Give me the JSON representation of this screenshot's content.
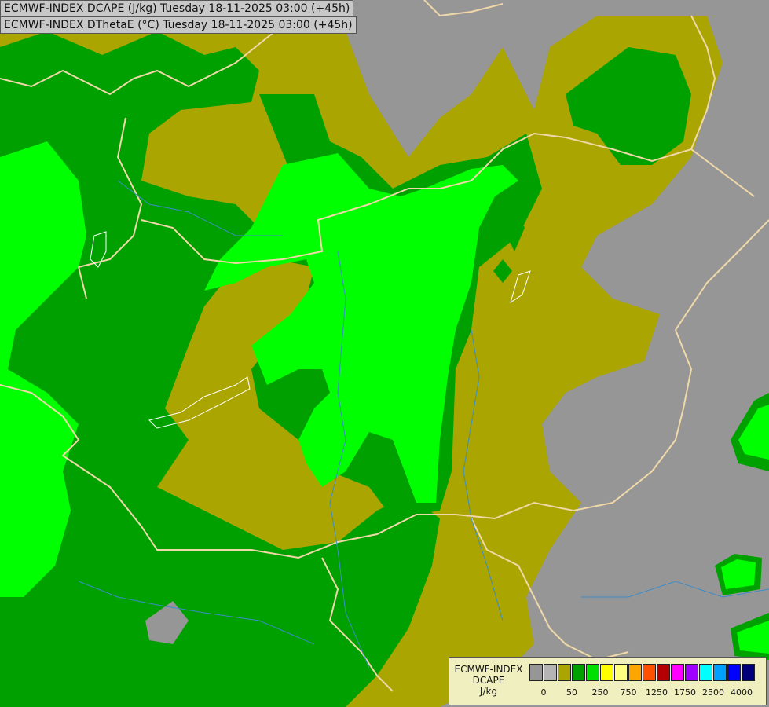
{
  "titles": {
    "line1": "ECMWF-INDEX DCAPE (J/kg) Tuesday 18-11-2025 03:00 (+45h)",
    "line2": "ECMWF-INDEX DThetaE (°C) Tuesday 18-11-2025 03:00 (+45h)"
  },
  "legend": {
    "name": "ECMWF-INDEX",
    "parameter": "DCAPE",
    "unit": "J/kg",
    "swatches": [
      "#969696",
      "#b4b4b4",
      "#aaa500",
      "#00a000",
      "#00e000",
      "#ffff00",
      "#ffff80",
      "#ffa500",
      "#ff5000",
      "#b40000",
      "#ff00ff",
      "#a000ff",
      "#00ffff",
      "#00a0ff",
      "#0000ff",
      "#00007a"
    ],
    "tick_labels": [
      "0",
      "50",
      "250",
      "750",
      "1250",
      "1750",
      "2500",
      "4000"
    ]
  },
  "colors": {
    "grey": "#969696",
    "olive": "#aaa500",
    "dark_green": "#00a000",
    "mid_green": "#00c800",
    "bright_green": "#00ff00",
    "border": "#f0d8a8",
    "river": "#3c8cc8"
  }
}
